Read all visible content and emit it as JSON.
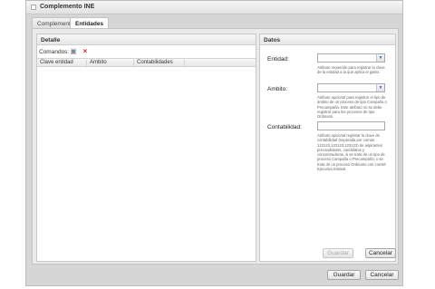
{
  "window": {
    "title": "Complemento INE"
  },
  "tabs": [
    {
      "label": "Complemento"
    },
    {
      "label": "Entidades"
    }
  ],
  "detail": {
    "title": "Detalle",
    "commands_label": "Comandos:",
    "icons": {
      "add": "add-icon",
      "delete": "delete-icon"
    },
    "columns": [
      "Clave entidad",
      "Ambito",
      "Contabilidades"
    ]
  },
  "datos": {
    "title": "Datos",
    "entidad": {
      "label": "Entidad:",
      "hint_pre": "Atributo ",
      "hint_em": "requerido",
      "hint_post": " para registrar la clave de la entidad a la que aplica el gasto."
    },
    "ambito": {
      "label": "Ambito:",
      "hint_pre": "Atributo ",
      "hint_em": "opcional",
      "hint_post": " para registrar el tipo de ámbito de un proceso de tipo Campaña o Precampaña. Este atributo no se debe registrar para los procesos de tipo Ordinario."
    },
    "contabilidad": {
      "label": "Contabilidad:",
      "hint_pre": "Atributo ",
      "hint_em": "opcional",
      "hint_post": " registrar la clave de contabilidad (separada por comas 123123,123123,123123) de aspirantes precandidatos, candidatos y concentradoras, si se trata de un tipo de proceso Campaña o Precampaña; o se trata de un proceso Ordinario con comité Ejecutivo Estatal."
    },
    "guardar_label": "Guardar",
    "cancelar_label": "Cancelar"
  },
  "footer": {
    "guardar_label": "Guardar",
    "cancelar_label": "Cancelar"
  }
}
